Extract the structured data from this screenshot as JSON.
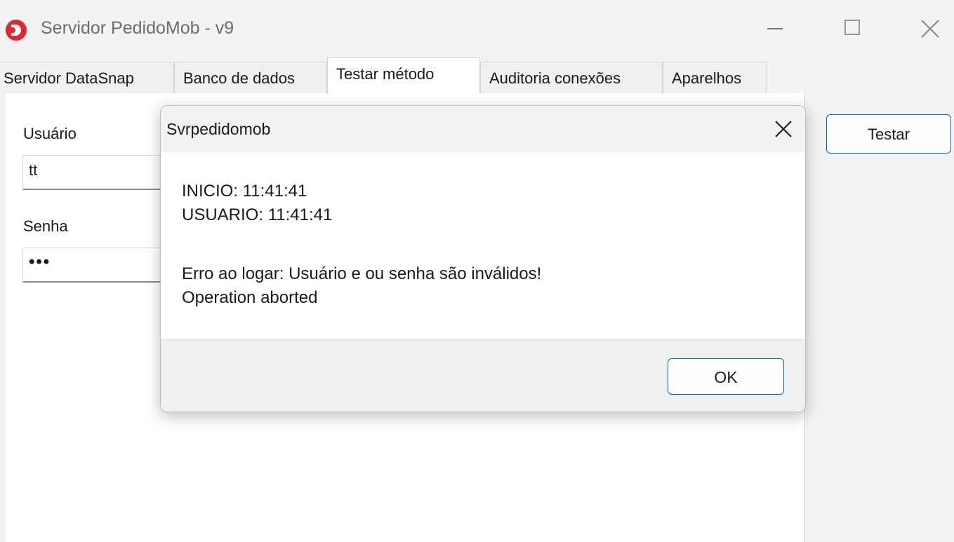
{
  "window": {
    "title": "Servidor PedidoMob - v9",
    "icons": {
      "app": "app-logo-icon",
      "minimize": "minimize-icon",
      "maximize": "maximize-icon",
      "close": "close-icon"
    },
    "accent_color": "#e0282e"
  },
  "tabs": [
    {
      "label": "Servidor DataSnap",
      "active": false
    },
    {
      "label": "Banco de dados",
      "active": false
    },
    {
      "label": "Testar método",
      "active": true
    },
    {
      "label": "Auditoria conexões",
      "active": false
    },
    {
      "label": "Aparelhos",
      "active": false
    }
  ],
  "form": {
    "usuario_label": "Usuário",
    "usuario_value": "tt",
    "senha_label": "Senha",
    "senha_value": "•••",
    "testar_label": "Testar"
  },
  "dialog": {
    "title": "Svrpedidomob",
    "lines": [
      "INICIO: 11:41:41",
      "USUARIO: 11:41:41",
      "Erro ao logar: Usuário e ou senha são inválidos!",
      "Operation aborted"
    ],
    "ok_label": "OK",
    "button_border_color": "#0067c0"
  }
}
